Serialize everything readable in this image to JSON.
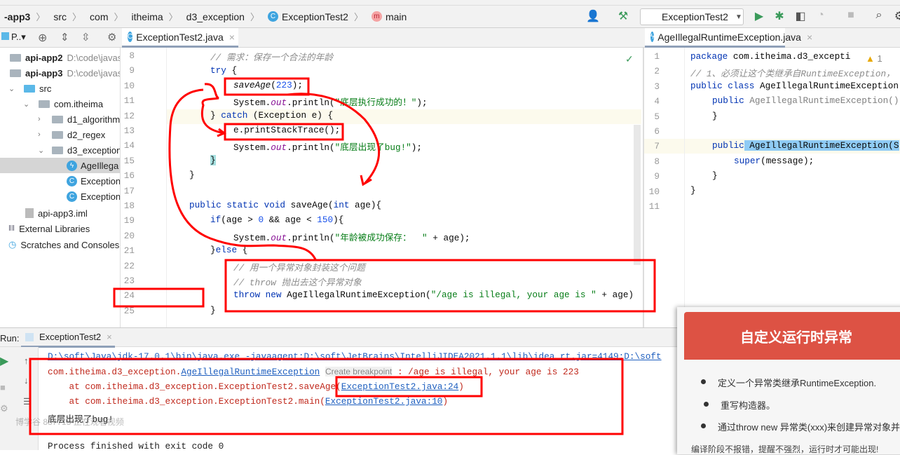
{
  "breadcrumb": [
    "-app3",
    "src",
    "com",
    "itheima",
    "d3_exception",
    "ExceptionTest2",
    "main"
  ],
  "toolbar": {
    "run_config": "ExceptionTest2",
    "icons": [
      "user-icon",
      "build-hammer-icon",
      "run-icon",
      "debug-icon",
      "coverage-icon",
      "profile-icon",
      "stop-icon",
      "search-icon"
    ]
  },
  "project_panel": {
    "title": "P..",
    "tree": [
      {
        "label": "api-app2",
        "path": "D:\\code\\javas",
        "bold": true
      },
      {
        "label": "api-app3",
        "path": "D:\\code\\javas",
        "bold": true
      },
      {
        "label": "src"
      },
      {
        "label": "com.itheima"
      },
      {
        "label": "d1_algorithm"
      },
      {
        "label": "d2_regex"
      },
      {
        "label": "d3_exception"
      },
      {
        "label": "AgeIllega",
        "selected": true
      },
      {
        "label": "Exception"
      },
      {
        "label": "Exception"
      },
      {
        "label": "api-app3.iml"
      },
      {
        "label": "External Libraries"
      },
      {
        "label": "Scratches and Consoles"
      }
    ]
  },
  "editor_left": {
    "tab": "ExceptionTest2.java",
    "line_numbers": [
      "8",
      "9",
      "10",
      "11",
      "12",
      "13",
      "14",
      "15",
      "16",
      "17",
      "18",
      "19",
      "20",
      "21",
      "22",
      "23",
      "24",
      "25"
    ],
    "lines": {
      "l8": "// 需求：保存一个合法的年龄",
      "l9": "try",
      "l10a": "saveAge",
      "l10b": "223",
      "l11a": "System.",
      "l11b": "out",
      "l11c": ".println(",
      "l11d": "\"底层执行成功的！\"",
      "l11e": ");",
      "l12a": "} ",
      "l12b": "catch",
      "l12c": " (Exception e) {",
      "l13": "e.printStackTrace();",
      "l14d": "\"底层出现了bug!\"",
      "l15": "}",
      "l16": "}",
      "l18a": "public static void",
      "l18b": " saveAge(",
      "l18c": "int",
      "l18d": " age){",
      "l19a": "if",
      "l19b": "(age > ",
      "l19c": "0",
      "l19d": " && age < ",
      "l19e": "150",
      "l19f": "){",
      "l20d": "\"年龄被成功保存：  \"",
      "l20e": " + age);",
      "l21a": "}",
      "l21b": "else",
      "l21c": " {",
      "l22": "// 用一个异常对象封装这个问题",
      "l23": "// throw 抛出去这个异常对象",
      "l24a": "throw new",
      "l24b": " AgeIllegalRuntimeException(",
      "l24c": "\"/age is illegal, your age is \"",
      "l24d": " + age)",
      "l25": "}"
    }
  },
  "editor_right": {
    "tab": "AgeIllegalRuntimeException.java",
    "warning_count": "1",
    "line_numbers": [
      "1",
      "2",
      "3",
      "4",
      "5",
      "6",
      "7",
      "8",
      "9",
      "10",
      "11"
    ],
    "lines": {
      "l1a": "package",
      "l1b": " com.itheima.d3_excepti",
      "l2": "// 1、必须让这个类继承自RuntimeException，",
      "l3a": "public class",
      "l3b": " AgeIllegalRuntimeException",
      "l4a": "public",
      "l4b": " AgeIllegalRuntimeException()",
      "l5": "}",
      "l7a": "public",
      "l7b": " AgeIllegalRuntimeException(S",
      "l8a": "super",
      "l8b": "(message);",
      "l9": "}",
      "l10": "}"
    }
  },
  "run": {
    "label": "Run:",
    "tab": "ExceptionTest2",
    "cmd": "D:\\soft\\Java\\jdk-17.0.1\\bin\\java.exe -javaagent:D:\\soft\\JetBrains\\IntelliJIDEA2021.1.1\\lib\\idea_rt.jar=4149:D:\\soft",
    "ex_pkg": "com.itheima.d3_exception.",
    "ex_class": "AgeIllegalRuntimeException",
    "ex_hint": "Create breakpoint",
    "ex_msg": ": /age is illegal, your age is 223",
    "trace1": "    at com.itheima.d3_exception.ExceptionTest2.saveAge(",
    "trace1_link": "ExceptionTest2.java:24",
    "close": ")",
    "trace2": "    at com.itheima.d3_exception.ExceptionTest2.main(",
    "trace2_link": "ExceptionTest2.java:10",
    "out": "底层出现了bug!",
    "watermark": "博学谷 887715 正在观看视频",
    "exit": "Process finished with exit code 0"
  },
  "slide": {
    "title": "自定义运行时异常",
    "bullets": [
      "定义一个异常类继承RuntimeException.",
      "重写构造器。",
      "通过throw new 异常类(xxx)来创建异常对象并"
    ],
    "footer": "编译阶段不报错，提醒不强烈，运行时才可能出现!"
  },
  "colors": {
    "annotation": "#ff0000",
    "slide_header": "#dd5244",
    "accent": "#3fa4df"
  }
}
